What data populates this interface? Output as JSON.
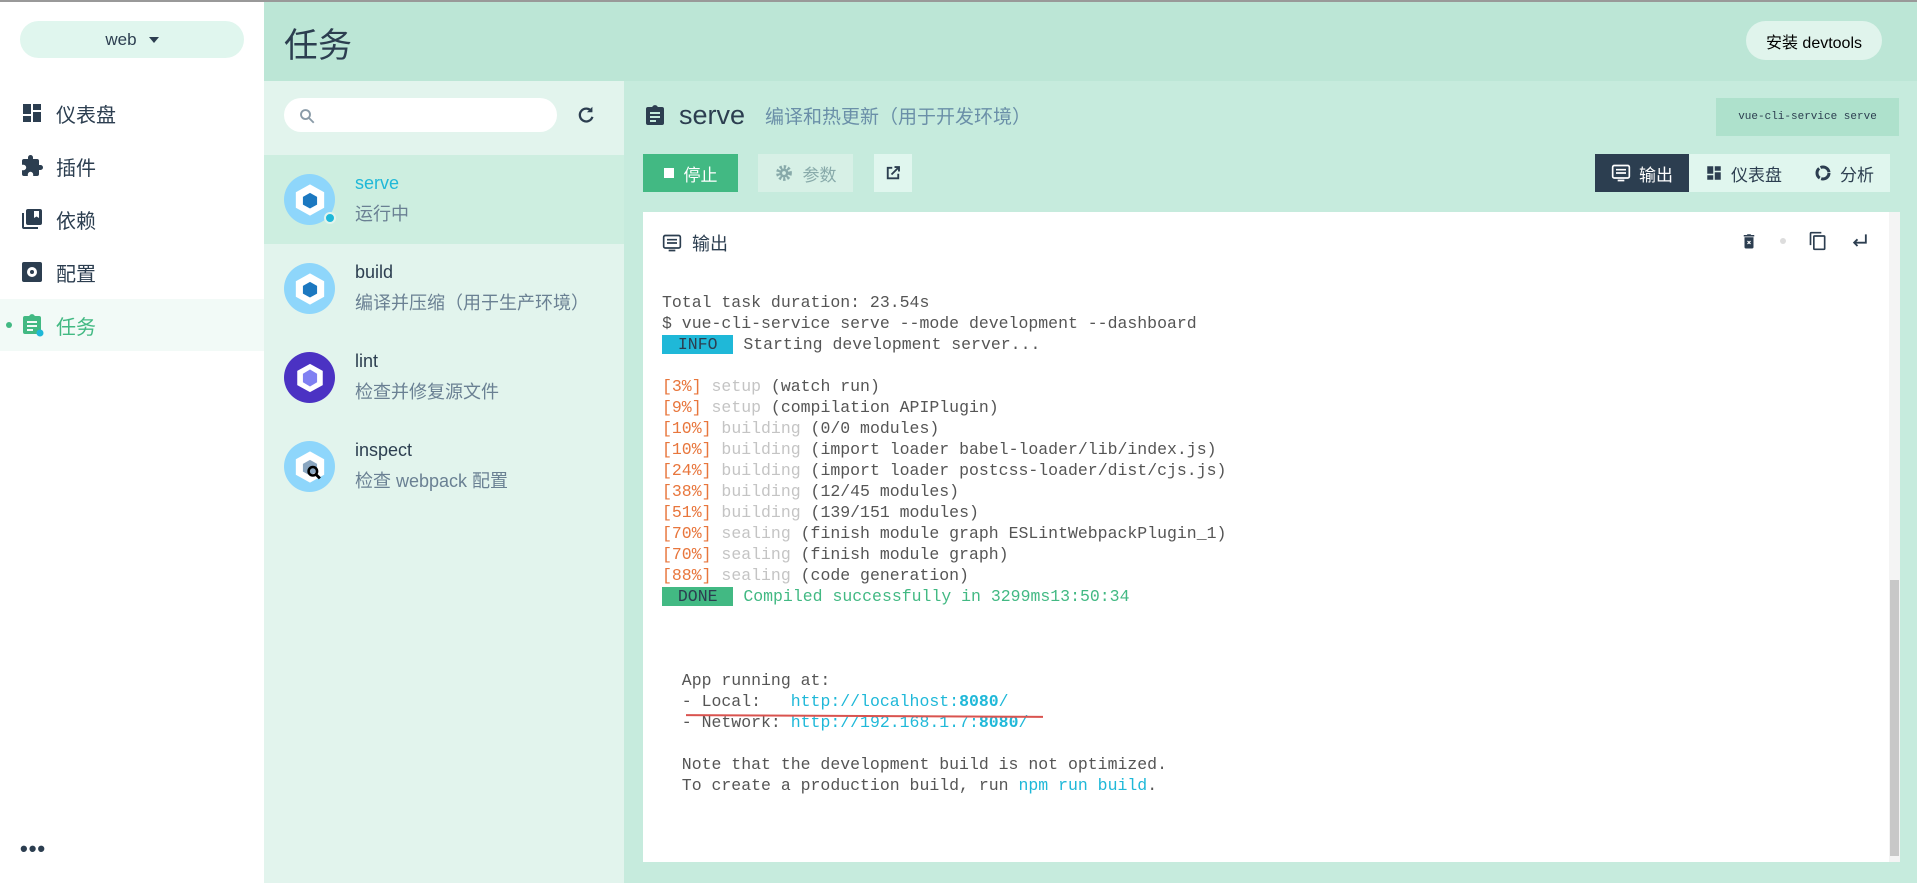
{
  "project": {
    "name": "web"
  },
  "sidebar": {
    "items": [
      {
        "label": "仪表盘",
        "icon": "dashboard-icon"
      },
      {
        "label": "插件",
        "icon": "puzzle-icon"
      },
      {
        "label": "依赖",
        "icon": "library-icon"
      },
      {
        "label": "配置",
        "icon": "settings-box-icon"
      },
      {
        "label": "任务",
        "icon": "clipboard-icon",
        "active": true
      }
    ],
    "more": "•••"
  },
  "header": {
    "title": "任务",
    "devtools_button": "安装 devtools"
  },
  "tasks": [
    {
      "name": "serve",
      "desc": "运行中",
      "selected": true,
      "status": "running"
    },
    {
      "name": "build",
      "desc": "编译并压缩（用于生产环境）"
    },
    {
      "name": "lint",
      "desc": "检查并修复源文件"
    },
    {
      "name": "inspect",
      "desc": "检查 webpack 配置"
    }
  ],
  "task_detail": {
    "name": "serve",
    "desc": "编译和热更新（用于开发环境）",
    "command": "vue-cli-service serve",
    "stop_label": "停止",
    "params_label": "参数",
    "tabs": [
      {
        "label": "输出",
        "active": true
      },
      {
        "label": "仪表盘"
      },
      {
        "label": "分析"
      }
    ],
    "output_title": "输出"
  },
  "colors": {
    "accent": "#42b983",
    "info": "#1fb8d8",
    "dark": "#2c3e50",
    "percent": "#e8763c"
  },
  "log": [
    [
      [
        "Total task duration: 23.54s",
        ""
      ]
    ],
    [
      [
        "$ vue-cli-service serve --mode development --dashboard",
        ""
      ]
    ],
    [
      [
        " INFO ",
        "tag info"
      ],
      [
        " Starting development server...",
        ""
      ]
    ],
    [],
    [
      [
        "[3%]",
        "pct"
      ],
      [
        " setup",
        "faint"
      ],
      [
        " (watch run)",
        ""
      ]
    ],
    [
      [
        "[9%]",
        "pct"
      ],
      [
        " setup",
        "faint"
      ],
      [
        " (compilation APIPlugin)",
        ""
      ]
    ],
    [
      [
        "[10%]",
        "pct"
      ],
      [
        " building",
        "faint"
      ],
      [
        " (0/0 modules)",
        ""
      ]
    ],
    [
      [
        "[10%]",
        "pct"
      ],
      [
        " building",
        "faint"
      ],
      [
        " (import loader babel-loader/lib/index.js)",
        ""
      ]
    ],
    [
      [
        "[24%]",
        "pct"
      ],
      [
        " building",
        "faint"
      ],
      [
        " (import loader postcss-loader/dist/cjs.js)",
        ""
      ]
    ],
    [
      [
        "[38%]",
        "pct"
      ],
      [
        " building",
        "faint"
      ],
      [
        " (12/45 modules)",
        ""
      ]
    ],
    [
      [
        "[51%]",
        "pct"
      ],
      [
        " building",
        "faint"
      ],
      [
        " (139/151 modules)",
        ""
      ]
    ],
    [
      [
        "[70%]",
        "pct"
      ],
      [
        " sealing",
        "faint"
      ],
      [
        " (finish module graph ESLintWebpackPlugin_1)",
        ""
      ]
    ],
    [
      [
        "[70%]",
        "pct"
      ],
      [
        " sealing",
        "faint"
      ],
      [
        " (finish module graph)",
        ""
      ]
    ],
    [
      [
        "[88%]",
        "pct"
      ],
      [
        " sealing",
        "faint"
      ],
      [
        " (code generation)",
        ""
      ]
    ],
    [
      [
        " DONE ",
        "tag done"
      ],
      [
        " Compiled successfully in 3299ms13:50:34",
        "green"
      ]
    ],
    [],
    [],
    [],
    [
      [
        "  App running at:",
        ""
      ]
    ],
    [
      [
        "  - Local:   ",
        ""
      ],
      [
        "http://localhost:",
        "link"
      ],
      [
        "8080",
        "bold"
      ],
      [
        "/",
        "link"
      ]
    ],
    [
      [
        "  - Network: ",
        ""
      ],
      [
        "http://192.168.1.7:",
        "link"
      ],
      [
        "8080",
        "bold"
      ],
      [
        "/",
        "link"
      ]
    ],
    [],
    [
      [
        "  Note that the development build is not optimized.",
        ""
      ]
    ],
    [
      [
        "  To create a production build, run ",
        ""
      ],
      [
        "npm run build",
        "link"
      ],
      [
        ".",
        ""
      ]
    ]
  ]
}
